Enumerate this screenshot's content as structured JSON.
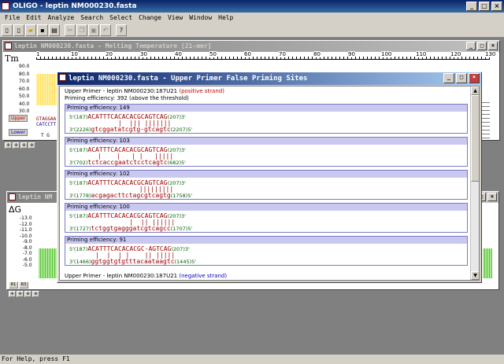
{
  "app": {
    "title": "OLIGO - leptin NM000230.fasta",
    "min": "_",
    "max": "□",
    "close": "×"
  },
  "menu": [
    "File",
    "Edit",
    "Analyze",
    "Search",
    "Select",
    "Change",
    "View",
    "Window",
    "Help"
  ],
  "status": "For Help, press F1",
  "tm_window": {
    "title": "leptin NM000230.fasta - Melting Temperature [21-mer]",
    "label": "Tm",
    "ruler_ticks": [
      "1",
      "10",
      "20",
      "30",
      "40",
      "50",
      "60",
      "70",
      "80",
      "90",
      "100",
      "110",
      "120",
      "130"
    ],
    "y_ticks": [
      "90.0",
      "80.0",
      "70.0",
      "60.0",
      "50.0",
      "40.0",
      "30.0"
    ],
    "upper_btn": "Upper",
    "lower_btn": "Lower",
    "seq_top": "GTAGGAA",
    "seq_bot": "CATCCTT",
    "seq_letters": "T G"
  },
  "dg_window": {
    "title": "leptin NM",
    "label": "ΔG",
    "y_ticks": [
      "-13.0",
      "-12.0",
      "-11.0",
      "-10.0",
      "-9.0",
      "-8.0",
      "-7.0",
      "-6.0",
      "-5.0"
    ],
    "btns": [
      "R1",
      "R3"
    ]
  },
  "dialog": {
    "title": "leptin NM000230.fasta - Upper Primer False Priming Sites",
    "header1_pre": "Upper Primer - leptin NM000230:187U21",
    "header1_strand": "(positive strand)",
    "header2": "Priming efficiency: 392 (above the threshold)",
    "footer_pre": "Upper Primer - leptin NM000230:187U21",
    "footer_strand": "(negative strand)",
    "sites": [
      {
        "head": "Priming efficiency: 149",
        "top_pre": "5'(187)",
        "top_seq": "ACATTTCACACACGCAGTCAG",
        "top_post": "(207)3'",
        "bars": "      |  ||| |||||||",
        "bot_pre": "3'(2226)",
        "bot_seq": "gtcggatatcgtg-gtcagtc",
        "bot_post": "(2207)5'"
      },
      {
        "head": "Priming efficiency: 103",
        "top_pre": "5'(187)",
        "top_seq": "ACATTTCACACACGCAGTCAG",
        "top_post": "(207)3'",
        "bars": " |    |   | |   |||||",
        "bot_pre": "3'(702)",
        "bot_seq": "tctcaccgaatctcctcagtc",
        "bot_post": "(682)5'"
      },
      {
        "head": "Priming efficiency: 102",
        "top_pre": "5'(187)",
        "top_seq": "ACATTTCACACACGCAGTCAG",
        "top_post": "(207)3'",
        "bars": "            |||||||||",
        "bot_pre": "3'(1778)",
        "bot_seq": "acgagacttctagcgtcagtg",
        "bot_post": "(1758)5'"
      },
      {
        "head": "Priming efficiency: 100",
        "top_pre": "5'(187)",
        "top_seq": "ACATTTCACACACGCAGTCAG",
        "top_post": "(207)3'",
        "bars": "         |  || ||||||",
        "bot_pre": "3'(1727)",
        "bot_seq": "tctggtgagggatcgtcagcc",
        "bot_post": "(1707)5'"
      },
      {
        "head": "Priming efficiency: 91",
        "top_pre": "5'(187)",
        "top_seq": "ACATTTCACACACGC-AGTCAG",
        "top_post": "(207)3'",
        "bars": "|  |  | |    || |||||",
        "bot_pre": "3'(1466)",
        "bot_seq": "ggtggtgtgtttacaataagtc",
        "bot_post": "(1445)5'"
      }
    ]
  }
}
